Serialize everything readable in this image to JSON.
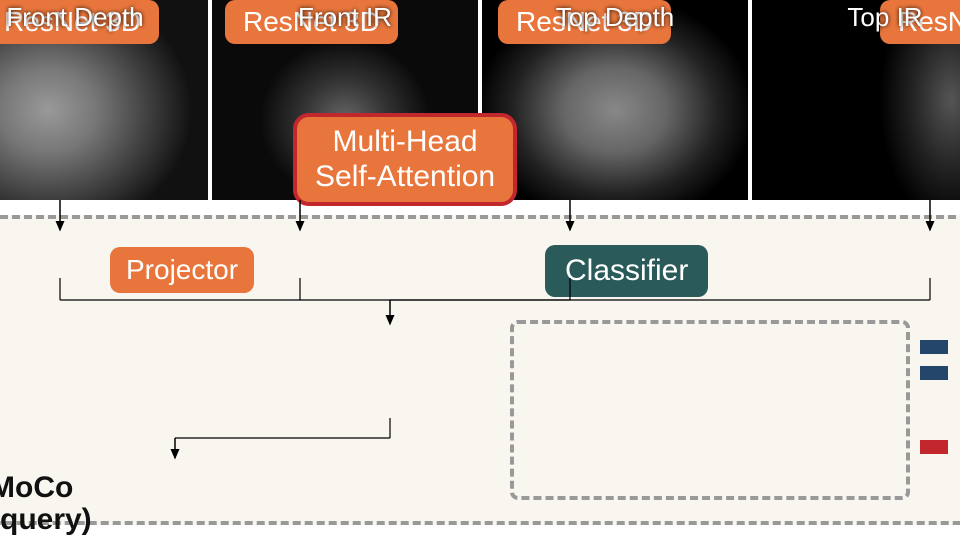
{
  "images": [
    {
      "label": "Front Depth"
    },
    {
      "label": "Front IR"
    },
    {
      "label": "Top Depth"
    },
    {
      "label": "Top IR"
    }
  ],
  "backbone": {
    "label": "ResNet 3D"
  },
  "attention": {
    "line1": "Multi-Head",
    "line2": "Self-Attention"
  },
  "projector": {
    "label": "Projector"
  },
  "classifier": {
    "label": "Classifier"
  },
  "side": {
    "line1": "MoCo",
    "line2": "(query)"
  }
}
